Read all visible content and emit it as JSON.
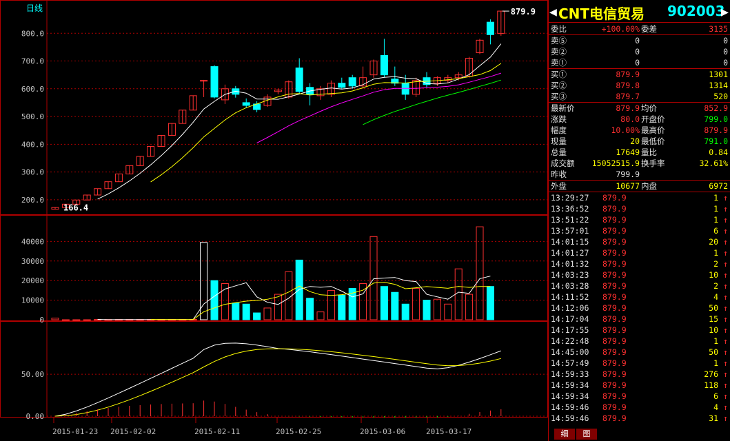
{
  "chart_title": "日线",
  "stock": {
    "name": "CNT电信贸易",
    "code": "902003",
    "left_arrow": "◀",
    "right_arrow": "▶"
  },
  "ratio": {
    "label": "委比",
    "value": "+100.00%",
    "diff_label": "委差",
    "diff": "3135"
  },
  "sell": [
    {
      "label": "卖⑤",
      "price": "0",
      "vol": "0"
    },
    {
      "label": "卖②",
      "price": "0",
      "vol": "0"
    },
    {
      "label": "卖①",
      "price": "0",
      "vol": "0"
    }
  ],
  "buy": [
    {
      "label": "买①",
      "price": "879.9",
      "vol": "1301"
    },
    {
      "label": "买②",
      "price": "879.8",
      "vol": "1314"
    },
    {
      "label": "买③",
      "price": "879.7",
      "vol": "520"
    }
  ],
  "stats": [
    {
      "l1": "最新价",
      "v1": "879.9",
      "l2": "均价",
      "v2": "852.9",
      "c1": "r",
      "c2": "r"
    },
    {
      "l1": "涨跌",
      "v1": "80.0",
      "l2": "开盘价",
      "v2": "799.0",
      "c1": "r",
      "c2": "g"
    },
    {
      "l1": "幅度",
      "v1": "10.00%",
      "l2": "最高价",
      "v2": "879.9",
      "c1": "r",
      "c2": "r"
    },
    {
      "l1": "现量",
      "v1": "20",
      "l2": "最低价",
      "v2": "791.0",
      "c1": "y",
      "c2": "g"
    },
    {
      "l1": "总量",
      "v1": "17649",
      "l2": "量比",
      "v2": "0.84",
      "c1": "y",
      "c2": "y"
    },
    {
      "l1": "成交额",
      "v1": "15052515.9",
      "l2": "换手率",
      "v2": "32.61%",
      "c1": "y",
      "c2": "y"
    },
    {
      "l1": "昨收",
      "v1": "799.9",
      "l2": "",
      "v2": "",
      "c1": "w",
      "c2": "w"
    }
  ],
  "outer": {
    "l1": "外盘",
    "v1": "10677",
    "l2": "内盘",
    "v2": "6972"
  },
  "ticks": [
    {
      "t": "13:29:27",
      "p": "879.9",
      "v": "1"
    },
    {
      "t": "13:36:52",
      "p": "879.9",
      "v": "1"
    },
    {
      "t": "13:51:22",
      "p": "879.9",
      "v": "1"
    },
    {
      "t": "13:57:01",
      "p": "879.9",
      "v": "6"
    },
    {
      "t": "14:01:15",
      "p": "879.9",
      "v": "20"
    },
    {
      "t": "14:01:27",
      "p": "879.9",
      "v": "1"
    },
    {
      "t": "14:01:32",
      "p": "879.9",
      "v": "2"
    },
    {
      "t": "14:03:23",
      "p": "879.9",
      "v": "10"
    },
    {
      "t": "14:03:28",
      "p": "879.9",
      "v": "2"
    },
    {
      "t": "14:11:52",
      "p": "879.9",
      "v": "4"
    },
    {
      "t": "14:12:06",
      "p": "879.9",
      "v": "50"
    },
    {
      "t": "14:17:04",
      "p": "879.9",
      "v": "15"
    },
    {
      "t": "14:17:55",
      "p": "879.9",
      "v": "10"
    },
    {
      "t": "14:22:48",
      "p": "879.9",
      "v": "1"
    },
    {
      "t": "14:45:00",
      "p": "879.9",
      "v": "50"
    },
    {
      "t": "14:57:49",
      "p": "879.9",
      "v": "1"
    },
    {
      "t": "14:59:33",
      "p": "879.9",
      "v": "276"
    },
    {
      "t": "14:59:34",
      "p": "879.9",
      "v": "118"
    },
    {
      "t": "14:59:34",
      "p": "879.9",
      "v": "6"
    },
    {
      "t": "14:59:46",
      "p": "879.9",
      "v": "4"
    },
    {
      "t": "14:59:46",
      "p": "879.9",
      "v": "31"
    }
  ],
  "tick_arrow": "↑",
  "tabs": {
    "left": "细",
    "right": "图"
  },
  "chart_data": {
    "type": "candlestick",
    "price_axis": {
      "min": 150,
      "max": 900,
      "ticks": [
        "800.0",
        "700.0",
        "600.0",
        "500.0",
        "400.0",
        "300.0",
        "200.0"
      ]
    },
    "last_label": "879.9",
    "low_label": "166.4",
    "volume_axis": {
      "ticks": [
        "40000",
        "30000",
        "20000",
        "10000",
        "0"
      ]
    },
    "indicator_axis": {
      "ticks": [
        "50.00",
        "0.00"
      ]
    },
    "dates": [
      "2015-01-23",
      "2015-02-02",
      "2015-02-11",
      "2015-02-25",
      "2015-03-06",
      "2015-03-17"
    ],
    "candles": [
      {
        "o": 166,
        "c": 172,
        "h": 172,
        "l": 166
      },
      {
        "o": 172,
        "c": 184,
        "h": 184,
        "l": 172
      },
      {
        "o": 184,
        "c": 199,
        "h": 199,
        "l": 184
      },
      {
        "o": 199,
        "c": 217,
        "h": 217,
        "l": 199
      },
      {
        "o": 217,
        "c": 240,
        "h": 240,
        "l": 217
      },
      {
        "o": 240,
        "c": 265,
        "h": 265,
        "l": 240
      },
      {
        "o": 265,
        "c": 293,
        "h": 293,
        "l": 265
      },
      {
        "o": 293,
        "c": 323,
        "h": 323,
        "l": 293
      },
      {
        "o": 323,
        "c": 356,
        "h": 356,
        "l": 323
      },
      {
        "o": 356,
        "c": 392,
        "h": 392,
        "l": 356
      },
      {
        "o": 392,
        "c": 432,
        "h": 432,
        "l": 392
      },
      {
        "o": 432,
        "c": 475,
        "h": 475,
        "l": 432
      },
      {
        "o": 475,
        "c": 523,
        "h": 523,
        "l": 475
      },
      {
        "o": 523,
        "c": 575,
        "h": 575,
        "l": 523
      },
      {
        "o": 630,
        "c": 630,
        "h": 632,
        "l": 570
      },
      {
        "o": 680,
        "c": 570,
        "h": 685,
        "l": 565
      },
      {
        "o": 560,
        "c": 600,
        "h": 615,
        "l": 545
      },
      {
        "o": 600,
        "c": 580,
        "h": 610,
        "l": 568
      },
      {
        "o": 550,
        "c": 540,
        "h": 565,
        "l": 530
      },
      {
        "o": 545,
        "c": 525,
        "h": 555,
        "l": 515
      },
      {
        "o": 540,
        "c": 570,
        "h": 580,
        "l": 535
      },
      {
        "o": 590,
        "c": 595,
        "h": 600,
        "l": 580
      },
      {
        "o": 570,
        "c": 625,
        "h": 630,
        "l": 565
      },
      {
        "o": 675,
        "c": 590,
        "h": 710,
        "l": 580
      },
      {
        "o": 605,
        "c": 580,
        "h": 620,
        "l": 540
      },
      {
        "o": 575,
        "c": 600,
        "h": 610,
        "l": 560
      },
      {
        "o": 580,
        "c": 620,
        "h": 630,
        "l": 570
      },
      {
        "o": 620,
        "c": 605,
        "h": 640,
        "l": 600
      },
      {
        "o": 640,
        "c": 610,
        "h": 650,
        "l": 600
      },
      {
        "o": 610,
        "c": 640,
        "h": 680,
        "l": 600
      },
      {
        "o": 650,
        "c": 700,
        "h": 705,
        "l": 640
      },
      {
        "o": 720,
        "c": 650,
        "h": 780,
        "l": 640
      },
      {
        "o": 635,
        "c": 620,
        "h": 680,
        "l": 610
      },
      {
        "o": 620,
        "c": 580,
        "h": 650,
        "l": 560
      },
      {
        "o": 580,
        "c": 630,
        "h": 640,
        "l": 570
      },
      {
        "o": 640,
        "c": 615,
        "h": 660,
        "l": 605
      },
      {
        "o": 620,
        "c": 640,
        "h": 645,
        "l": 610
      },
      {
        "o": 630,
        "c": 640,
        "h": 650,
        "l": 620
      },
      {
        "o": 640,
        "c": 650,
        "h": 660,
        "l": 630
      },
      {
        "o": 645,
        "c": 710,
        "h": 715,
        "l": 640
      },
      {
        "o": 730,
        "c": 775,
        "h": 780,
        "l": 725
      },
      {
        "o": 840,
        "c": 795,
        "h": 850,
        "l": 760
      },
      {
        "o": 799,
        "c": 879.9,
        "h": 879.9,
        "l": 791
      }
    ],
    "volumes": [
      800,
      0,
      0,
      0,
      120,
      100,
      100,
      100,
      100,
      100,
      100,
      120,
      150,
      200,
      39500,
      20000,
      18500,
      8500,
      8000,
      3500,
      6000,
      13000,
      24500,
      30500,
      11000,
      4000,
      15000,
      12500,
      16000,
      18500,
      42500,
      17000,
      14000,
      8000,
      16000,
      10000,
      10500,
      8000,
      26000,
      13000,
      47500,
      17000
    ]
  }
}
